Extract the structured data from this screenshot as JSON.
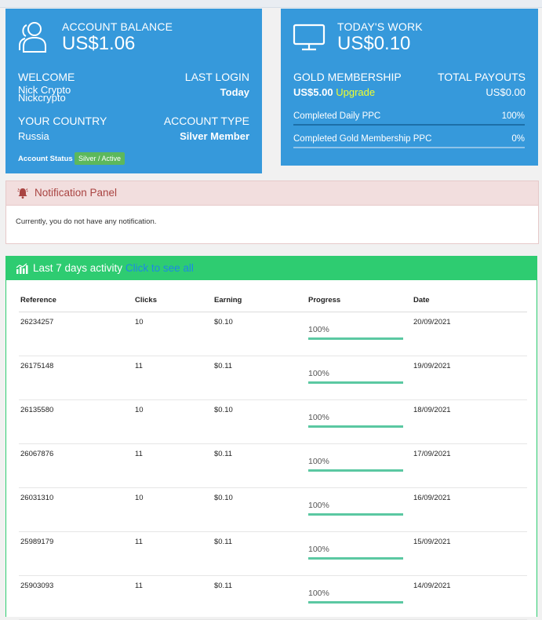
{
  "account": {
    "balance_label": "ACCOUNT BALANCE",
    "balance_value": "US$1.06",
    "welcome_label": "WELCOME",
    "welcome_value_line1": "Nick Crypto",
    "welcome_value_line2": "Nickcrypto",
    "last_login_label": "LAST LOGIN",
    "last_login_value": "Today",
    "country_label": "YOUR COUNTRY",
    "country_value": "Russia",
    "account_type_label": "ACCOUNT TYPE",
    "account_type_value": "Silver Member",
    "status_label": "Account Status",
    "status_badge": "Silver / Active",
    "icon": "users-icon"
  },
  "work": {
    "label": "TODAY'S WORK",
    "value": "US$0.10",
    "gold_label": "GOLD MEMBERSHIP",
    "gold_price": "US$5.00",
    "upgrade_label": "Upgrade",
    "payouts_label": "TOTAL PAYOUTS",
    "payouts_value": "US$0.00",
    "daily_ppc_label": "Completed Daily PPC",
    "daily_ppc_value": "100%",
    "gold_ppc_label": "Completed Gold Membership PPC",
    "gold_ppc_value": "0%",
    "icon": "monitor-icon"
  },
  "notification": {
    "title": "Notification Panel",
    "message": "Currently, you do not have any notification.",
    "icon": "bell-icon"
  },
  "activity": {
    "title": "Last 7 days activity",
    "link": "Click to see all",
    "icon": "bar-chart-icon",
    "columns": [
      "Reference",
      "Clicks",
      "Earning",
      "Progress",
      "Date"
    ],
    "rows": [
      {
        "reference": "26234257",
        "clicks": "10",
        "earning": "$0.10",
        "progress": "100%",
        "date": "20/09/2021"
      },
      {
        "reference": "26175148",
        "clicks": "11",
        "earning": "$0.11",
        "progress": "100%",
        "date": "19/09/2021"
      },
      {
        "reference": "26135580",
        "clicks": "10",
        "earning": "$0.10",
        "progress": "100%",
        "date": "18/09/2021"
      },
      {
        "reference": "26067876",
        "clicks": "11",
        "earning": "$0.11",
        "progress": "100%",
        "date": "17/09/2021"
      },
      {
        "reference": "26031310",
        "clicks": "10",
        "earning": "$0.10",
        "progress": "100%",
        "date": "16/09/2021"
      },
      {
        "reference": "25989179",
        "clicks": "11",
        "earning": "$0.11",
        "progress": "100%",
        "date": "15/09/2021"
      },
      {
        "reference": "25903093",
        "clicks": "11",
        "earning": "$0.11",
        "progress": "100%",
        "date": "14/09/2021"
      }
    ]
  },
  "colors": {
    "card_blue": "#3699db",
    "upgrade_yellow": "#f1ff2b",
    "activity_green": "#2ecc71",
    "notif_bg": "#f2dede",
    "notif_text": "#a94442",
    "progress_fill": "#5bc8a2"
  }
}
